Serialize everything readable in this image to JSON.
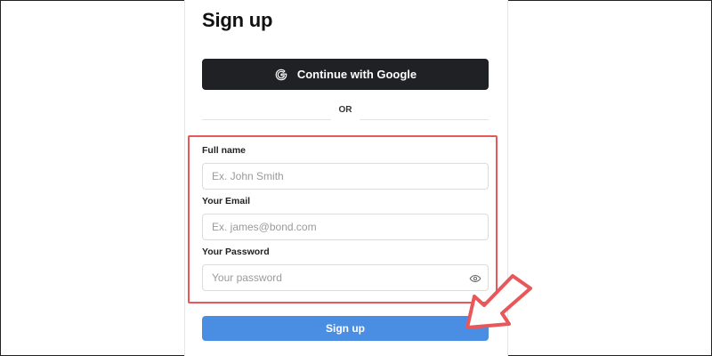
{
  "page": {
    "title": "Sign up"
  },
  "google_button": {
    "label": "Continue with Google",
    "icon": "google-g-icon"
  },
  "divider": {
    "label": "OR"
  },
  "form": {
    "full_name": {
      "label": "Full name",
      "placeholder": "Ex. John Smith",
      "value": ""
    },
    "email": {
      "label": "Your Email",
      "placeholder": "Ex. james@bond.com",
      "value": ""
    },
    "password": {
      "label": "Your Password",
      "placeholder": "Your password",
      "value": "",
      "toggle_icon": "eye-icon"
    }
  },
  "submit_button": {
    "label": "Sign up"
  },
  "annotation": {
    "highlight_color": "#e8575a",
    "arrow_color": "#e8575a"
  },
  "colors": {
    "google_button_bg": "#202124",
    "submit_button_bg": "#4a8ee4"
  }
}
